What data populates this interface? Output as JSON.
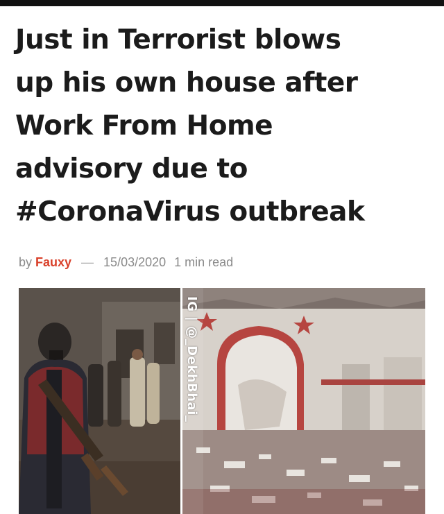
{
  "article": {
    "headline_lines": [
      "Just in Terrorist blows",
      "up his own house after",
      "Work From Home",
      "advisory due to",
      "#CoronaVirus outbreak"
    ],
    "byline": {
      "prefix": "by",
      "author": "Fauxy",
      "separator": "—",
      "date": "15/03/2020",
      "read_time": "1 min read"
    },
    "images": {
      "left_alt": "gunman-photo",
      "right_alt": "damaged-room-photo",
      "watermark": "IG | @_DekhBhai_"
    }
  },
  "colors": {
    "headline": "#1b1b1b",
    "author": "#d9402a",
    "meta": "#8a8a8a",
    "top_bar": "#111111"
  }
}
